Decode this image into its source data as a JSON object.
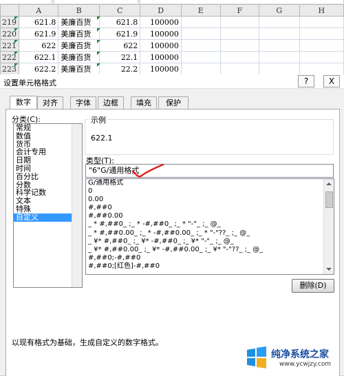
{
  "sheet": {
    "columns": [
      "A",
      "B",
      "C",
      "D",
      "E",
      "F",
      "G",
      "H"
    ],
    "rows": [
      {
        "num": "219",
        "a": "621.8",
        "b": "美廉百货",
        "c": "621.8",
        "d": "100000"
      },
      {
        "num": "220",
        "a": "621.9",
        "b": "美廉百货",
        "c": "621.9",
        "d": "100000"
      },
      {
        "num": "221",
        "a": "622",
        "b": "美廉百货",
        "c": "622",
        "d": "100000"
      },
      {
        "num": "222",
        "a": "622.1",
        "b": "美廉百货",
        "c": "22.1",
        "d": "100000"
      },
      {
        "num": "223",
        "a": "622.2",
        "b": "美廉百货",
        "c": "22.2",
        "d": "100000"
      }
    ],
    "marker_color": "#1a8a3a"
  },
  "dialog": {
    "title": "设置单元格格式",
    "help": "?",
    "close": "X",
    "tabs": [
      "数字",
      "对齐",
      "字体",
      "边框",
      "填充",
      "保护"
    ],
    "category_label": "分类(C):",
    "categories": [
      "常规",
      "数值",
      "货币",
      "会计专用",
      "日期",
      "时间",
      "百分比",
      "分数",
      "科学记数",
      "文本",
      "特殊",
      "自定义"
    ],
    "selected_category": "自定义",
    "sample_label": "示例",
    "sample_value": "622.1",
    "type_label": "类型(T):",
    "type_value": "\"6\"G/通用格式",
    "formats": [
      "G/通用格式",
      "0",
      "0.00",
      "#,##0",
      "#,##0.00",
      "_ * #,##0_ ;_ * -#,##0_ ;_ * \"-\"_ ;_ @_",
      "_ * #,##0.00_ ;_ * -#,##0.00_ ;_ * \"-\"??_ ;_ @_",
      "_ ¥* #,##0_ ;_ ¥* -#,##0_ ;_ ¥* \"-\"_ ;_ @_",
      "_ ¥* #,##0.00_ ;_ ¥* -#,##0.00_ ;_ ¥* \"-\"??_ ;_ @_",
      "#,##0;-#,##0",
      "#,##0;[红色]-#,##0"
    ],
    "delete_button": "删除(D)",
    "description": "以现有格式为基础，生成自定义的数字格式。"
  },
  "watermark": {
    "text": "纯净系统之家",
    "url": "www.ycwjzy.com"
  }
}
